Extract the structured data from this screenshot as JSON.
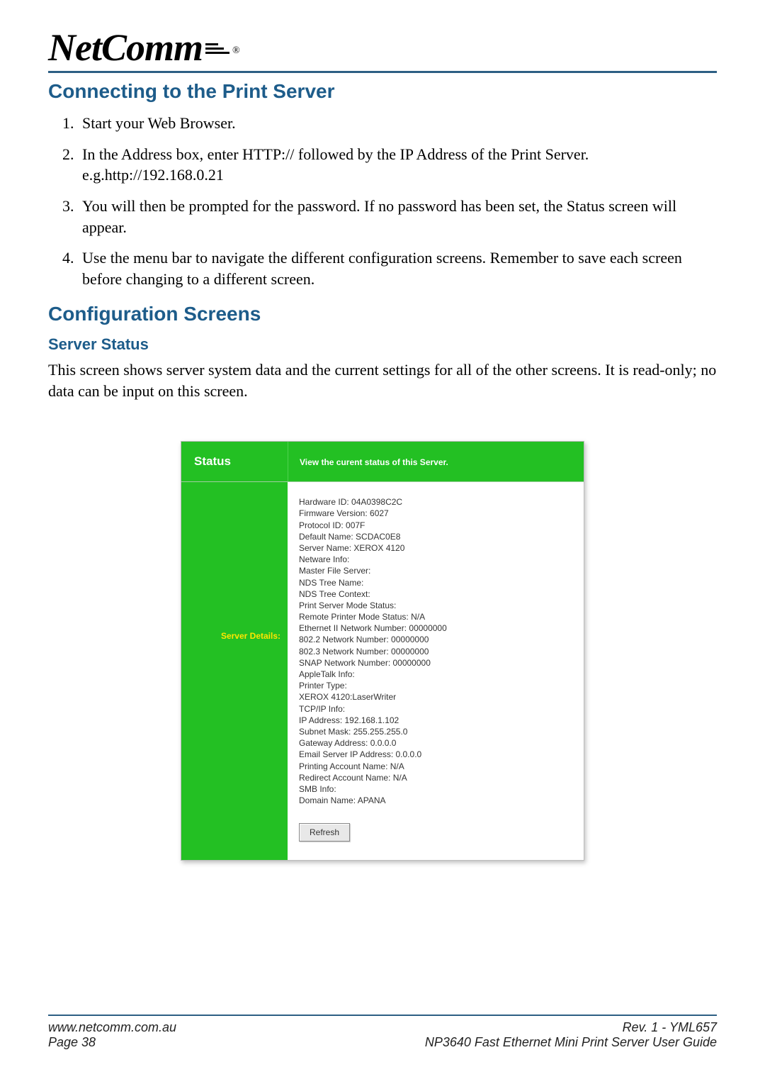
{
  "logo": {
    "brand": "NetComm",
    "reg": "®"
  },
  "headings": {
    "connecting": "Connecting to the Print Server",
    "config": "Configuration Screens",
    "server_status": "Server Status"
  },
  "steps": [
    "Start your Web Browser.",
    "In the Address box, enter HTTP:// followed by the IP Address of the Print Server.  e.g.http://192.168.0.21",
    "You will then be prompted for the password. If no password has been set, the Status screen will appear.",
    "Use the menu bar to navigate the different configuration screens. Remember to save each screen before changing to a different screen."
  ],
  "server_status_desc": "This screen shows server system data and the current settings for all of the other screens. It is read-only; no data can be input on this screen.",
  "shot": {
    "title": "Status",
    "subtitle": "View the curent status of this Server.",
    "left_label": "Server Details:",
    "lines": [
      "Hardware ID: 04A0398C2C",
      "Firmware Version: 6027",
      "Protocol ID: 007F",
      "Default Name: SCDAC0E8",
      "Server Name: XEROX 4120",
      "Netware Info:",
      "Master File Server:",
      "NDS Tree Name:",
      "NDS Tree Context:",
      "Print Server Mode Status:",
      "Remote Printer Mode Status: N/A",
      "Ethernet II Network Number: 00000000",
      "802.2 Network Number: 00000000",
      "802.3 Network Number: 00000000",
      "SNAP Network Number: 00000000",
      "AppleTalk Info:",
      "Printer Type:",
      "XEROX 4120:LaserWriter",
      "TCP/IP Info:",
      "IP Address: 192.168.1.102",
      "Subnet Mask: 255.255.255.0",
      "Gateway Address: 0.0.0.0",
      "Email Server IP Address: 0.0.0.0",
      "Printing Account Name: N/A",
      "Redirect Account Name: N/A",
      "SMB Info:",
      "Domain Name: APANA"
    ],
    "refresh": "Refresh"
  },
  "footer": {
    "url": "www.netcomm.com.au",
    "rev": "Rev. 1 - YML657",
    "page": "Page 38",
    "guide": "NP3640  Fast Ethernet Mini Print Server User Guide"
  }
}
